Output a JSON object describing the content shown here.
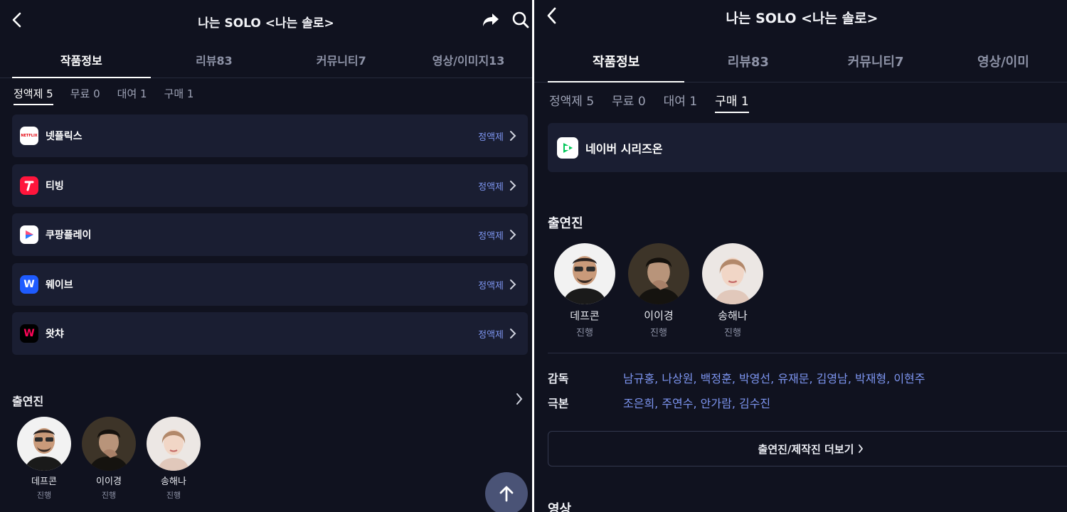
{
  "left": {
    "title": "나는 SOLO <나는 솔로>",
    "tabs": [
      "작품정보",
      "리뷰83",
      "커뮤니티7",
      "영상/이미지13"
    ],
    "subtabs": [
      "정액제 5",
      "무료 0",
      "대여 1",
      "구매 1"
    ],
    "providers": [
      {
        "name": "넷플릭스",
        "type": "정액제",
        "logo_text": "NETFLIX",
        "color": "#e50914"
      },
      {
        "name": "티빙",
        "type": "정액제",
        "logo_text": "",
        "color": "#ff153c"
      },
      {
        "name": "쿠팡플레이",
        "type": "정액제",
        "logo_text": "",
        "color": "#2a7bff"
      },
      {
        "name": "웨이브",
        "type": "정액제",
        "logo_text": "W",
        "color": "#1e5bff"
      },
      {
        "name": "왓챠",
        "type": "정액제",
        "logo_text": "W",
        "color": "#ff0558"
      }
    ],
    "cast_title": "출연진",
    "cast": [
      {
        "name": "데프콘",
        "role": "진행"
      },
      {
        "name": "이이경",
        "role": "진행"
      },
      {
        "name": "송해나",
        "role": "진행"
      }
    ]
  },
  "right": {
    "title": "나는 SOLO <나는 솔로>",
    "tabs": [
      "작품정보",
      "리뷰83",
      "커뮤니티7",
      "영상/이미"
    ],
    "subtabs": [
      "정액제 5",
      "무료 0",
      "대여 1",
      "구매 1"
    ],
    "provider": {
      "name": "네이버 시리즈온",
      "color": "#03c75a"
    },
    "cast_title": "출연진",
    "cast": [
      {
        "name": "데프콘",
        "role": "진행"
      },
      {
        "name": "이이경",
        "role": "진행"
      },
      {
        "name": "송해나",
        "role": "진행"
      }
    ],
    "credits": [
      {
        "label": "감독",
        "value": "남규홍, 나상원, 백정훈, 박영선, 유재문, 김영남, 박재형, 이현주"
      },
      {
        "label": "극본",
        "value": "조은희, 주연수, 안가람, 김수진"
      }
    ],
    "more_button": "출연진/제작진 더보기",
    "next_section": "영상"
  },
  "colors": {
    "background": "#10121f",
    "card": "#1a1e32",
    "accent_link": "#7d95f0",
    "fab": "#4a5376"
  }
}
